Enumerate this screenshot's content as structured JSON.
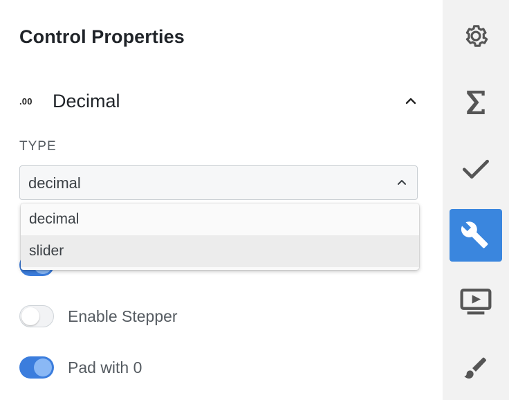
{
  "panel": {
    "title": "Control Properties",
    "section": {
      "icon_text": ".00",
      "label": "Decimal",
      "expanded": true
    },
    "type_label": "TYPE",
    "type_select": {
      "value": "decimal",
      "options": [
        "decimal",
        "slider"
      ],
      "hovered_option": "slider"
    },
    "toggles": [
      {
        "label": "Enable Stepper",
        "on": false
      },
      {
        "label": "Pad with 0",
        "on": true
      }
    ]
  },
  "sidebar": {
    "items": [
      {
        "icon": "gear-icon",
        "active": false
      },
      {
        "icon": "sigma-icon",
        "active": false
      },
      {
        "icon": "checkmark-icon",
        "active": false
      },
      {
        "icon": "wrench-icon",
        "active": true
      },
      {
        "icon": "preview-icon",
        "active": false
      },
      {
        "icon": "brush-icon",
        "active": false
      }
    ]
  },
  "colors": {
    "accent": "#3a86de",
    "toggle_on": "#3b7ddd",
    "sidebar_bg": "#f2f2f2",
    "text": "#1f2328",
    "muted_text": "#555b61"
  }
}
